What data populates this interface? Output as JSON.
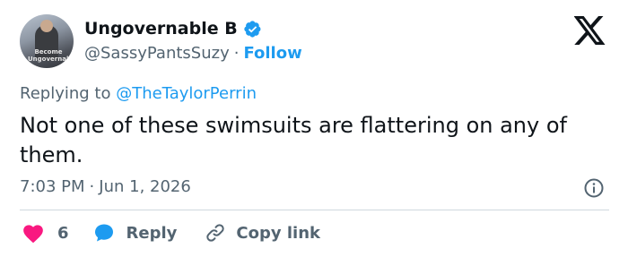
{
  "tweet": {
    "author": {
      "display_name": "Ungovernable B",
      "handle": "@SassyPantsSuzy",
      "verified": true,
      "avatar_shirt_text": "Become\nUngovernable"
    },
    "separator": "·",
    "follow_label": "Follow",
    "replying_prefix": "Replying to ",
    "replying_to": "@TheTaylorPerrin",
    "text": "Not one of these swimsuits are flattering on any of them.",
    "time": "7:03 PM",
    "date": "Jun 1, 2026",
    "likes": "6",
    "reply_label": "Reply",
    "copy_link_label": "Copy link"
  },
  "icons": {
    "brand": "x-logo-icon",
    "verified": "verified-badge-icon",
    "info": "info-icon",
    "like": "heart-icon",
    "reply": "speech-bubble-icon",
    "link": "link-icon"
  },
  "colors": {
    "accent": "#1d9bf0",
    "like": "#f91880",
    "secondary_text": "#536471",
    "primary_text": "#0f1419",
    "divider": "#cfd9de"
  }
}
